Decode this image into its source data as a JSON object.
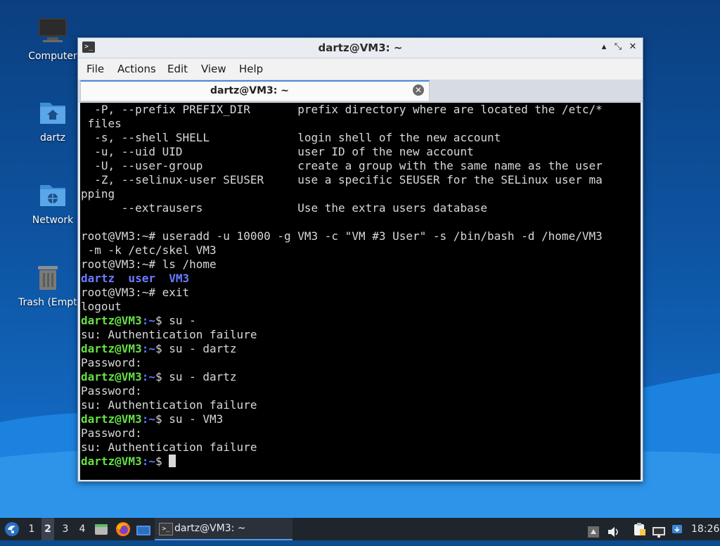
{
  "desktop": {
    "icons": [
      {
        "label": "Computer",
        "icon": "computer-icon"
      },
      {
        "label": "dartz",
        "icon": "home-folder-icon"
      },
      {
        "label": "Network",
        "icon": "network-folder-icon"
      },
      {
        "label": "Trash (Empty)",
        "icon": "trash-icon"
      }
    ]
  },
  "window": {
    "title": "dartz@VM3: ~",
    "buttons": {
      "minimize": "▴",
      "maximize": "⤡",
      "close": "✕"
    },
    "menu": [
      "File",
      "Actions",
      "Edit",
      "View",
      "Help"
    ],
    "tab": {
      "label": "dartz@VM3: ~",
      "close": "✕"
    }
  },
  "terminal": {
    "prompt_user": "dartz@VM3",
    "prompt_path": ":~",
    "lines": [
      "  -P, --prefix PREFIX_DIR       prefix directory where are located the /etc/*",
      " files",
      "  -s, --shell SHELL             login shell of the new account",
      "  -u, --uid UID                 user ID of the new account",
      "  -U, --user-group              create a group with the same name as the user",
      "  -Z, --selinux-user SEUSER     use a specific SEUSER for the SELinux user ma",
      "pping",
      "      --extrausers              Use the extra users database",
      "",
      "root@VM3:~# useradd -u 10000 -g VM3 -c \"VM #3 User\" -s /bin/bash -d /home/VM3",
      " -m -k /etc/skel VM3",
      "root@VM3:~# ls /home",
      "dartz  user  VM3",
      "root@VM3:~# exit",
      "logout",
      "dartz@VM3:~$ su -",
      "su: Authentication failure",
      "dartz@VM3:~$ su - dartz",
      "Password:",
      "dartz@VM3:~$ su - dartz",
      "Password:",
      "su: Authentication failure",
      "dartz@VM3:~$ su - VM3",
      "Password:",
      "su: Authentication failure",
      "dartz@VM3:~$ "
    ]
  },
  "taskbar": {
    "workspaces": [
      "1",
      "2",
      "3",
      "4"
    ],
    "active_workspace": "2",
    "task_label": "dartz@VM3: ~",
    "clock": "18:26"
  },
  "colors": {
    "prompt_green": "#66e046",
    "prompt_path_blue": "#5a7cff",
    "dir_blue": "#6b7cff",
    "accent": "#4b8ad8"
  }
}
